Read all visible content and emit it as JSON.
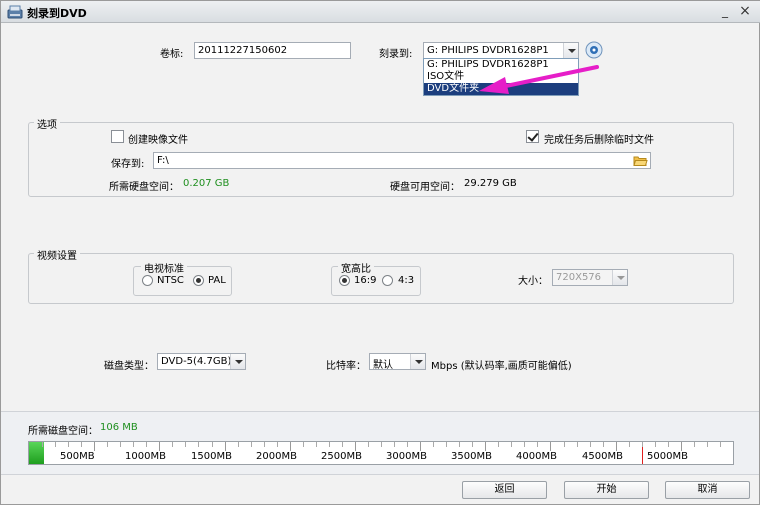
{
  "window": {
    "title": "刻录到DVD",
    "minimize": "_",
    "close": "×"
  },
  "top": {
    "volume_label": "卷标:",
    "volume_value": "20111227150602",
    "burn_to_label": "刻录到:",
    "burn_to_value": "G: PHILIPS  DVDR1628P1",
    "dropdown_items": [
      "G: PHILIPS  DVDR1628P1",
      "ISO文件",
      "DVD文件夹"
    ]
  },
  "options": {
    "title": "选项",
    "create_image_label": "创建映像文件",
    "create_image_checked": false,
    "delete_temp_label": "完成任务后删除临时文件",
    "delete_temp_checked": true,
    "save_to_label": "保存到:",
    "save_to_value": "F:\\",
    "required_space_label": "所需硬盘空间：",
    "required_space_value": "0.207 GB",
    "available_space_label": "硬盘可用空间：",
    "available_space_value": "29.279 GB"
  },
  "video": {
    "title": "视频设置",
    "tv_standard_title": "电视标准",
    "ntsc_label": "NTSC",
    "pal_label": "PAL",
    "tv_standard_selected": "PAL",
    "aspect_title": "宽高比",
    "aspect_169_label": "16:9",
    "aspect_43_label": "4:3",
    "aspect_selected": "16:9",
    "size_label": "大小：",
    "size_value": "720X576"
  },
  "disc": {
    "disc_type_label": "磁盘类型：",
    "disc_type_value": "DVD-5(4.7GB)",
    "bitrate_label": "比特率：",
    "bitrate_value": "默认",
    "bitrate_note": "Mbps (默认码率,画质可能偏低)"
  },
  "space_bar": {
    "label": "所需磁盘空间：",
    "value": "106 MB",
    "used_fraction": 0.021,
    "limit_mark_mb": 4700,
    "max_mb": 5400,
    "ticks": [
      "500MB",
      "1000MB",
      "1500MB",
      "2000MB",
      "2500MB",
      "3000MB",
      "3500MB",
      "4000MB",
      "4500MB",
      "5000MB"
    ]
  },
  "buttons": {
    "back": "返回",
    "start": "开始",
    "cancel": "取消"
  },
  "colors": {
    "green_value": "#1f8f1f",
    "annotation_arrow": "#e61ec8",
    "used_bar": "#2fbf2f",
    "limit_line": "#e02020"
  }
}
